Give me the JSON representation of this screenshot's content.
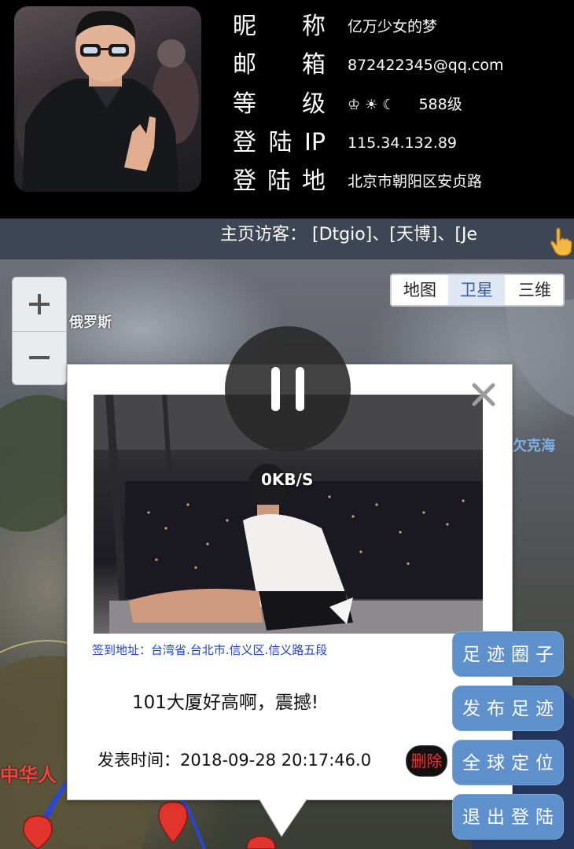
{
  "profile": {
    "rows": [
      {
        "label": "昵称",
        "value": "亿万少女的梦"
      },
      {
        "label": "邮箱",
        "value": "872422345@qq.com"
      },
      {
        "label": "等级",
        "value": "588级",
        "icons": "♔☀☾"
      },
      {
        "label": "登陆IP",
        "value": "115.34.132.89"
      },
      {
        "label": "登陆地",
        "value": "北京市朝阳区安贞路"
      }
    ],
    "visitors": "主页访客：  [Dtgio]、[天博]、[Je"
  },
  "map": {
    "types": [
      "地图",
      "卫星",
      "三维"
    ],
    "selected_type": "卫星",
    "zoom_in": "+",
    "zoom_out": "−",
    "labels": {
      "russia": "俄罗斯",
      "sea": "欠克海",
      "china": "中华人"
    }
  },
  "popup": {
    "checkin": "签到地址：台湾省.台北市.信义区.信义路五段",
    "text": "101大厦好高啊，震撼!",
    "time": "发表时间：2018-09-28 20:17:46.0",
    "delete_label": "删除"
  },
  "player": {
    "speed": "0KB/S"
  },
  "side_buttons": [
    "足迹圈子",
    "发布足迹",
    "全球定位",
    "退出登陆"
  ],
  "colors": {
    "side_button": "#5e90cc",
    "visitor_bar": "#3e4656",
    "delete_text": "#ff2a2a"
  }
}
